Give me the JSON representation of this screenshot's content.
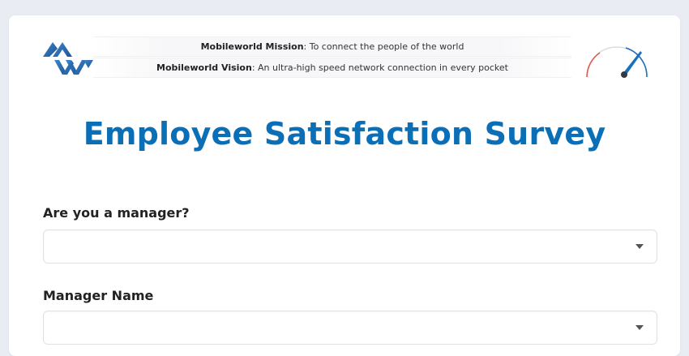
{
  "banner": {
    "mission_label": "Mobileworld Mission",
    "mission_text": ": To connect the people of the world",
    "vision_label": "Mobileworld Vision",
    "vision_text": ": An ultra-high speed network connection in every pocket"
  },
  "icons": {
    "logo": "mobileworld-logo",
    "gauge": "speedometer-gauge-icon",
    "dropdown": "caret-down-icon"
  },
  "colors": {
    "title": "#0b6fb7",
    "logo_blue": "#2a6db2",
    "gauge_blue": "#1b6fbf",
    "gauge_red": "#e35b4d",
    "background": "#e9edf3"
  },
  "survey": {
    "title": "Employee Satisfaction Survey",
    "questions": [
      {
        "label": "Are you a manager?",
        "value": ""
      },
      {
        "label": "Manager Name",
        "value": ""
      }
    ]
  }
}
